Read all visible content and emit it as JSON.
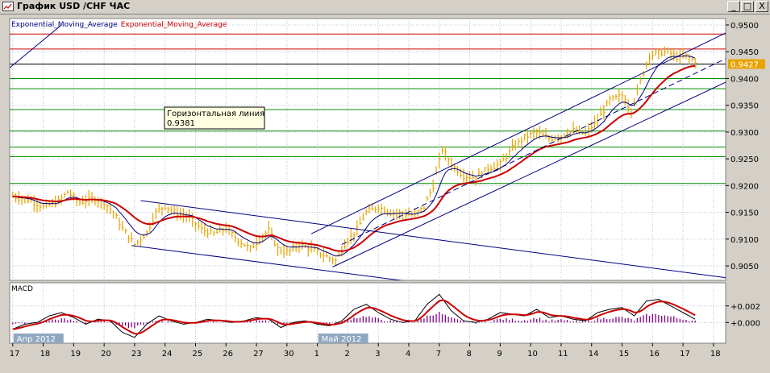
{
  "window": {
    "title": "График USD /CHF ЧАС",
    "buttons": {
      "minimize": "_",
      "maximize": "□",
      "close": "X"
    }
  },
  "colors": {
    "background": "#ffffff",
    "frame": "#d4d0c8",
    "grid": "#b8c4d8",
    "price_bars": "#e8a300",
    "ema_fast": "#000080",
    "ema_slow": "#cc0000",
    "channel": "#000080",
    "green_levels": "#009000",
    "red_levels": "#cc0000",
    "current_line": "#000000",
    "price_tag_bg": "#e8a300",
    "macd_hist": "#800080",
    "date_tag_bg": "#8fa8c0"
  },
  "chart_data": [
    {
      "type": "line",
      "panel": "main",
      "indicator_labels": [
        "Exponential_Moving_Average",
        "Exponential_Moving_Average"
      ],
      "y_ticks": [
        "0.9500",
        "0.9450",
        "0.9400",
        "0.9350",
        "0.9300",
        "0.9250",
        "0.9200",
        "0.9150",
        "0.9100",
        "0.9050"
      ],
      "ylim": [
        0.9023,
        0.9512
      ],
      "xlim": [
        -1,
        234
      ],
      "current_price": "0.9427",
      "annotation": {
        "title": "Горизонтальная линия",
        "value": "0.9381"
      },
      "grid": true,
      "horizontal_levels": {
        "red": [
          0.9483,
          0.9455
        ],
        "black": [
          0.9427
        ],
        "green": [
          0.94,
          0.9381,
          0.9342,
          0.9302,
          0.9272,
          0.9254,
          0.9204
        ]
      },
      "channels": [
        {
          "name": "desc-upper",
          "p1": [
            42,
            0.9172
          ],
          "p2": [
            234,
            0.9028
          ],
          "style": "solid"
        },
        {
          "name": "desc-lower",
          "p1": [
            39,
            0.9088
          ],
          "p2": [
            130,
            0.9021
          ],
          "style": "solid"
        },
        {
          "name": "asc-upper",
          "p1": [
            98,
            0.911
          ],
          "p2": [
            234,
            0.9485
          ],
          "style": "solid"
        },
        {
          "name": "asc-lower",
          "p1": [
            105,
            0.9048
          ],
          "p2": [
            234,
            0.9393
          ],
          "style": "solid"
        },
        {
          "name": "asc-mid",
          "p1": [
            108,
            0.909
          ],
          "p2": [
            234,
            0.9437
          ],
          "style": "dashed"
        },
        {
          "name": "left-fragment",
          "p1": [
            -1,
            0.942
          ],
          "p2": [
            16,
            0.95
          ],
          "style": "solid"
        }
      ],
      "anchors": [
        [
          0,
          0.918
        ],
        [
          6,
          0.9172
        ],
        [
          10,
          0.916
        ],
        [
          15,
          0.917
        ],
        [
          18,
          0.9188
        ],
        [
          22,
          0.9168
        ],
        [
          26,
          0.9176
        ],
        [
          30,
          0.9168
        ],
        [
          33,
          0.915
        ],
        [
          36,
          0.912
        ],
        [
          40,
          0.909
        ],
        [
          44,
          0.9112
        ],
        [
          47,
          0.915
        ],
        [
          50,
          0.9162
        ],
        [
          54,
          0.9148
        ],
        [
          58,
          0.914
        ],
        [
          62,
          0.9118
        ],
        [
          66,
          0.911
        ],
        [
          70,
          0.912
        ],
        [
          74,
          0.9098
        ],
        [
          78,
          0.9082
        ],
        [
          81,
          0.91
        ],
        [
          84,
          0.9117
        ],
        [
          87,
          0.9082
        ],
        [
          90,
          0.9075
        ],
        [
          94,
          0.909
        ],
        [
          98,
          0.9082
        ],
        [
          102,
          0.907
        ],
        [
          106,
          0.906
        ],
        [
          109,
          0.909
        ],
        [
          113,
          0.9118
        ],
        [
          116,
          0.915
        ],
        [
          120,
          0.916
        ],
        [
          124,
          0.915
        ],
        [
          128,
          0.9148
        ],
        [
          132,
          0.9145
        ],
        [
          135,
          0.916
        ],
        [
          138,
          0.92
        ],
        [
          141,
          0.9268
        ],
        [
          144,
          0.924
        ],
        [
          148,
          0.9218
        ],
        [
          152,
          0.9215
        ],
        [
          156,
          0.9232
        ],
        [
          160,
          0.924
        ],
        [
          164,
          0.927
        ],
        [
          168,
          0.929
        ],
        [
          172,
          0.93
        ],
        [
          176,
          0.9288
        ],
        [
          180,
          0.9292
        ],
        [
          184,
          0.9303
        ],
        [
          188,
          0.9297
        ],
        [
          192,
          0.9322
        ],
        [
          196,
          0.936
        ],
        [
          200,
          0.9368
        ],
        [
          203,
          0.934
        ],
        [
          206,
          0.9395
        ],
        [
          209,
          0.9443
        ],
        [
          212,
          0.9448
        ],
        [
          215,
          0.945
        ],
        [
          218,
          0.944
        ],
        [
          221,
          0.9442
        ],
        [
          224,
          0.9432
        ]
      ]
    },
    {
      "type": "line",
      "panel": "macd",
      "label": "MACD",
      "y_ticks": [
        "+0.002",
        "+0.000"
      ],
      "ylim": [
        -0.0025,
        0.0048
      ],
      "grid": true,
      "anchors": [
        [
          0,
          -0.0008
        ],
        [
          4,
          -0.0002
        ],
        [
          8,
          0.0
        ],
        [
          12,
          0.0008
        ],
        [
          16,
          0.0012
        ],
        [
          20,
          0.0006
        ],
        [
          24,
          -0.0002
        ],
        [
          28,
          0.0004
        ],
        [
          32,
          0.0002
        ],
        [
          36,
          -0.0012
        ],
        [
          40,
          -0.0018
        ],
        [
          44,
          -0.0002
        ],
        [
          48,
          0.0008
        ],
        [
          52,
          0.0002
        ],
        [
          56,
          -0.0002
        ],
        [
          60,
          0.0
        ],
        [
          64,
          0.0004
        ],
        [
          68,
          0.0002
        ],
        [
          72,
          0.0
        ],
        [
          76,
          0.0002
        ],
        [
          80,
          0.0006
        ],
        [
          84,
          0.0004
        ],
        [
          88,
          -0.0006
        ],
        [
          92,
          0.0
        ],
        [
          96,
          0.0002
        ],
        [
          100,
          -0.0002
        ],
        [
          104,
          -0.0004
        ],
        [
          108,
          0.0002
        ],
        [
          112,
          0.0016
        ],
        [
          116,
          0.0022
        ],
        [
          120,
          0.0012
        ],
        [
          124,
          0.0004
        ],
        [
          128,
          0.0
        ],
        [
          132,
          0.0002
        ],
        [
          136,
          0.0022
        ],
        [
          140,
          0.0034
        ],
        [
          144,
          0.0014
        ],
        [
          148,
          0.0002
        ],
        [
          152,
          0.0
        ],
        [
          156,
          0.0004
        ],
        [
          160,
          0.0012
        ],
        [
          164,
          0.001
        ],
        [
          168,
          0.0008
        ],
        [
          172,
          0.0016
        ],
        [
          176,
          0.0006
        ],
        [
          180,
          0.0008
        ],
        [
          184,
          0.0004
        ],
        [
          188,
          0.0002
        ],
        [
          192,
          0.0012
        ],
        [
          196,
          0.0016
        ],
        [
          200,
          0.0018
        ],
        [
          204,
          0.0008
        ],
        [
          208,
          0.0026
        ],
        [
          212,
          0.0028
        ],
        [
          216,
          0.002
        ],
        [
          220,
          0.0012
        ],
        [
          224,
          0.0004
        ]
      ]
    }
  ],
  "x_axis": {
    "ticks": [
      {
        "x": 0,
        "label": "17"
      },
      {
        "x": 10,
        "label": "18"
      },
      {
        "x": 20,
        "label": "19"
      },
      {
        "x": 30,
        "label": "20"
      },
      {
        "x": 40,
        "label": "23"
      },
      {
        "x": 50,
        "label": "24"
      },
      {
        "x": 60,
        "label": "25"
      },
      {
        "x": 70,
        "label": "26"
      },
      {
        "x": 80,
        "label": "27"
      },
      {
        "x": 90,
        "label": "30"
      },
      {
        "x": 100,
        "label": "1"
      },
      {
        "x": 110,
        "label": "2"
      },
      {
        "x": 120,
        "label": "3"
      },
      {
        "x": 130,
        "label": "4"
      },
      {
        "x": 140,
        "label": "7"
      },
      {
        "x": 150,
        "label": "8"
      },
      {
        "x": 160,
        "label": "9"
      },
      {
        "x": 170,
        "label": "10"
      },
      {
        "x": 180,
        "label": "11"
      },
      {
        "x": 190,
        "label": "14"
      },
      {
        "x": 200,
        "label": "15"
      },
      {
        "x": 210,
        "label": "16"
      },
      {
        "x": 220,
        "label": "17"
      },
      {
        "x": 230,
        "label": "18"
      }
    ],
    "month_tags": [
      {
        "x": 0,
        "label": "Апр 2012"
      },
      {
        "x": 100,
        "label": "Май 2012"
      }
    ]
  }
}
